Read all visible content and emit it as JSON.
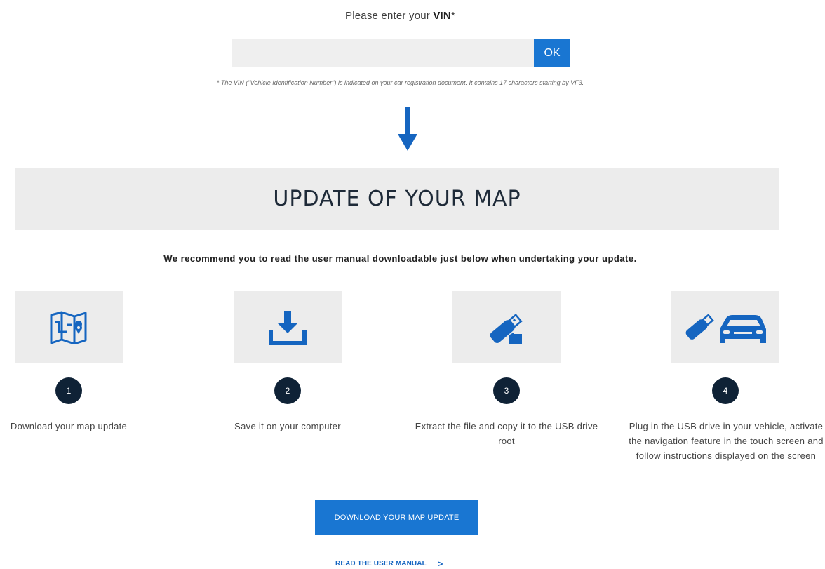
{
  "vin": {
    "prompt_prefix": "Please enter your ",
    "prompt_bold": "VIN",
    "prompt_suffix": "*",
    "input_value": "",
    "input_placeholder": "",
    "ok_label": "OK",
    "note": "* The VIN (\"Vehicle Identification Number\") is indicated on your car registration document. It contains 17 characters starting by VF3."
  },
  "update": {
    "title": "UPDATE OF YOUR MAP",
    "recommendation": "We recommend you to read the user manual downloadable just below when undertaking your update."
  },
  "steps": [
    {
      "number": "1",
      "icon": "map-icon",
      "text": "Download your map update"
    },
    {
      "number": "2",
      "icon": "download-icon",
      "text": "Save it on your computer"
    },
    {
      "number": "3",
      "icon": "usb-drive-icon",
      "text": "Extract the file and copy it to the USB drive root"
    },
    {
      "number": "4",
      "icon": "usb-car-icon",
      "text": "Plug in the USB drive in your vehicle, activate the navigation feature in the touch screen and follow instructions displayed on the screen"
    }
  ],
  "actions": {
    "download_label": "DOWNLOAD YOUR MAP UPDATE",
    "manual_label": "READ THE USER MANUAL",
    "manual_chevron": ">"
  },
  "colors": {
    "accent": "#1976d2",
    "icon_blue": "#1565c0",
    "badge": "#0f2236",
    "tile_bg": "#ececec"
  }
}
